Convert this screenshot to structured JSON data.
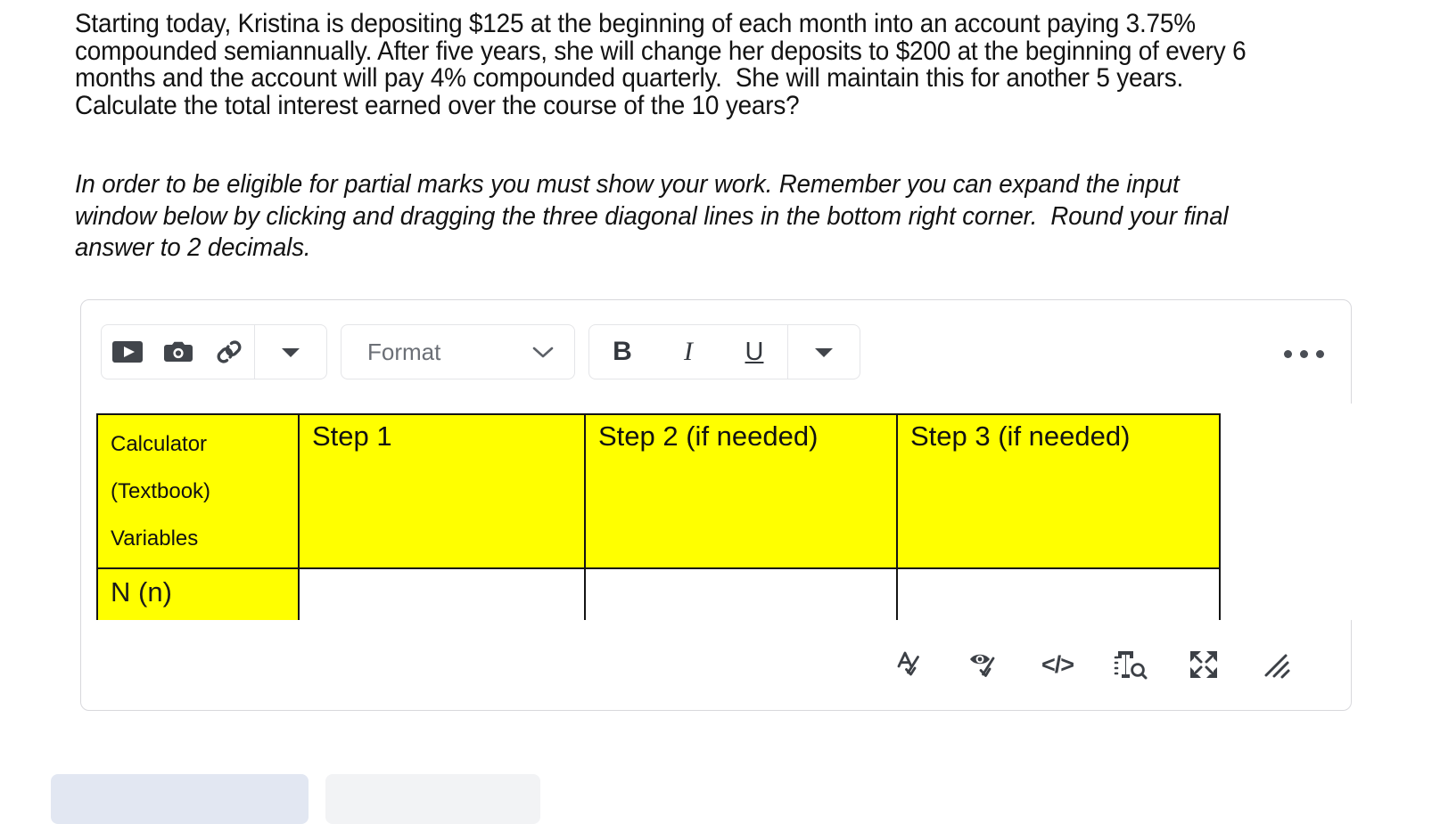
{
  "question": {
    "body": "Starting today, Kristina is depositing $125 at the beginning of each month into an account paying 3.75% compounded semiannually. After five years, she will change her deposits to $200 at the beginning of every 6 months and the account will pay 4% compounded quarterly.  She will maintain this for another 5 years. Calculate the total interest earned over the course of the 10 years?",
    "instructions": "In order to be eligible for partial marks you must show your work. Remember you can expand the input window below by clicking and dragging the three diagonal lines in the bottom right corner.  Round your final answer to 2 decimals."
  },
  "editor": {
    "toolbar": {
      "insert_video_icon": "video-icon",
      "insert_image_icon": "camera-icon",
      "insert_link_icon": "link-icon",
      "insert_more_caret": "caret-down-icon",
      "format_select": {
        "label": "Format",
        "chevron": "chevron-down-icon"
      },
      "bold_label": "B",
      "italic_label": "I",
      "underline_label": "U",
      "text_more_caret": "caret-down-icon",
      "more_options_icon": "ellipsis-icon"
    },
    "status_bar": {
      "spellcheck_icon": "spellcheck-icon",
      "accessibility_icon": "accessibility-check-icon",
      "html_editor_icon": "code-icon",
      "html_editor_label": "</>",
      "word_count_icon": "word-count-icon",
      "fullscreen_icon": "fullscreen-icon",
      "resize_handle_icon": "resize-handle-icon"
    },
    "content_table": {
      "header_first_cell_lines": [
        "Calculator",
        "(Textbook)",
        "Variables"
      ],
      "headers": [
        "Step 1",
        "Step 2 (if needed)",
        "Step 3 (if needed)"
      ],
      "rows": [
        {
          "label": "N (n)",
          "cells": [
            "",
            "",
            ""
          ]
        },
        {
          "label": "",
          "cells": [
            "",
            "",
            ""
          ]
        }
      ],
      "header_fill": "#ffff00",
      "label_fill": "#ffff00",
      "cell_fill": "#ffffff",
      "border_color": "#141414"
    }
  },
  "page_actions": {
    "primary_label": "",
    "secondary_label": "",
    "primary_color": "#e2e7f2",
    "secondary_color": "#f2f3f5"
  }
}
